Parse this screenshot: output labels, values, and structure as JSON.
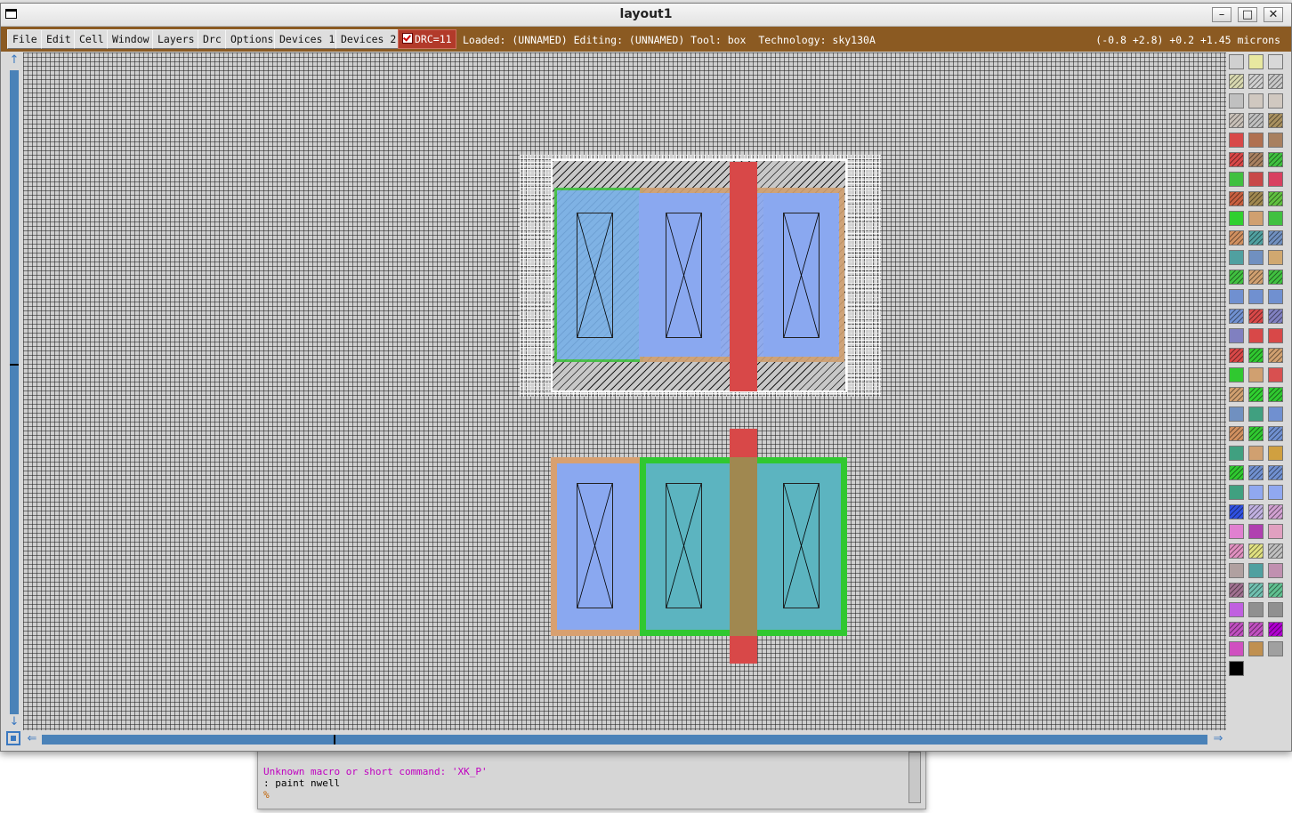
{
  "window": {
    "title": "layout1",
    "minimize_glyph": "–",
    "maximize_glyph": "□",
    "close_glyph": "✕"
  },
  "menubar": {
    "items": [
      {
        "label": "File"
      },
      {
        "label": "Edit"
      },
      {
        "label": "Cell"
      },
      {
        "label": "Window"
      },
      {
        "label": "Layers"
      },
      {
        "label": "Drc"
      },
      {
        "label": "Options"
      },
      {
        "label": "Devices 1"
      },
      {
        "label": "Devices 2"
      }
    ],
    "drc_label": "DRC=11",
    "status": "Loaded: (UNNAMED) Editing: (UNNAMED) Tool: box  Technology: sky130A",
    "coords": "(-0.8 +2.8) +0.2 +1.45 microns"
  },
  "scroll": {
    "up_glyph": "↑",
    "down_glyph": "↓",
    "left_glyph": "⇐",
    "right_glyph": "⇒"
  },
  "console": {
    "error_line": "Unknown macro or short command: 'XK_P'",
    "cmd_line": ": paint nwell",
    "prompt": "%"
  },
  "colors": {
    "menubar": "#8b5a22",
    "drc": "#b23a2a",
    "poly": "#d84848",
    "ndiff": "#30c830",
    "pdiff": "#d8a070",
    "metal": "#8aa8f0"
  },
  "palette_colors": [
    "#d0d0d0",
    "#e8e8a0",
    "#d8d8d8",
    "#d8d8b0",
    "#d0d0d0",
    "#c8c8c8",
    "#c0c0c0",
    "#d0c8c0",
    "#d0c8c0",
    "#c8c0b8",
    "#c0c0c0",
    "#a89060",
    "#d84848",
    "#b07050",
    "#a88060",
    "#d84848",
    "#a88060",
    "#40c040",
    "#40c040",
    "#c84848",
    "#d84060",
    "#c86040",
    "#a08850",
    "#60c040",
    "#30d030",
    "#d0a070",
    "#40c040",
    "#d09060",
    "#50a0a0",
    "#7090c0",
    "#50a0a0",
    "#7090c0",
    "#d0a870",
    "#40c040",
    "#d0a070",
    "#40c040",
    "#7090d0",
    "#7090d0",
    "#7090d0",
    "#7090d0",
    "#d84848",
    "#8080c0",
    "#8080c0",
    "#d84848",
    "#d84848",
    "#d84848",
    "#30c830",
    "#d0a070",
    "#30c830",
    "#d0a070",
    "#d85050",
    "#d0a070",
    "#30d030",
    "#30c830",
    "#7090c0",
    "#40a080",
    "#7090d0",
    "#d09060",
    "#30c830",
    "#7090d0",
    "#40a080",
    "#d0a070",
    "#d0a040",
    "#30c830",
    "#7090d0",
    "#7090d0",
    "#40a080",
    "#90a8f0",
    "#90a8f0",
    "#3050e0",
    "#c0b0e0",
    "#d0a0d0",
    "#e080d0",
    "#b040b0",
    "#e0a0c0",
    "#e090c0",
    "#e0e080",
    "#c0c0c0",
    "#b0a0a0",
    "#50a0a0",
    "#c090b0",
    "#a07090",
    "#70c0b0",
    "#60c090",
    "#c060e0",
    "#909090",
    "#909090",
    "#c050c0",
    "#c050c0",
    "#b000d0",
    "#d050c0",
    "#c09050",
    "#a0a0a0",
    "#000000"
  ]
}
